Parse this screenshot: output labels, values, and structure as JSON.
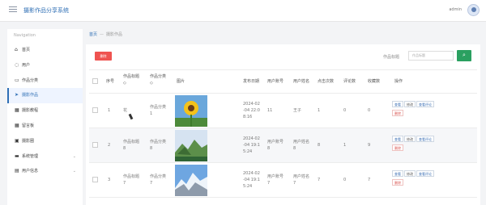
{
  "header": {
    "title": "摄影作品分享系统",
    "user": "admin"
  },
  "sidebar": {
    "title": "Navigation",
    "items": [
      {
        "label": "首页",
        "icon": "home-icon"
      },
      {
        "label": "用户",
        "icon": "user-icon"
      },
      {
        "label": "作品分类",
        "icon": "monitor-icon"
      },
      {
        "label": "摄影作品",
        "icon": "send-icon"
      },
      {
        "label": "摄影教程",
        "icon": "tutorial-icon"
      },
      {
        "label": "留言板",
        "icon": "grid-icon"
      },
      {
        "label": "摄影圈",
        "icon": "circle-icon"
      },
      {
        "label": "系统管理",
        "icon": "settings-icon"
      },
      {
        "label": "用户信息",
        "icon": "user-info-icon"
      }
    ]
  },
  "breadcrumb": {
    "home": "首页",
    "separator": "—",
    "current": "摄影作品"
  },
  "toolbar": {
    "delete_label": "删除",
    "search_label": "作品标题",
    "search_placeholder": "作品标题",
    "search_icon": "search-icon"
  },
  "table": {
    "headers": [
      "序号",
      "作品标题",
      "作品分类",
      "图片",
      "发布日期",
      "用户账号",
      "用户姓名",
      "点击次数",
      "评论数",
      "收藏数",
      "操作"
    ],
    "sort_marks": [
      "◇",
      "◇"
    ],
    "rows": [
      {
        "index": "1",
        "title": "花",
        "category": "作品分类\n1",
        "date": "2024-02\n-04 22:0\n8:16",
        "account": "11",
        "name": "王子",
        "clicks": "1",
        "comments": "0",
        "favorites": "0",
        "image": "sunflower-photo"
      },
      {
        "index": "2",
        "title": "作品标题\n8",
        "category": "作品分类\n8",
        "date": "2024-02\n-04 19:1\n5:24",
        "account": "用户账号\n8",
        "name": "用户姓名\n8",
        "clicks": "8",
        "comments": "1",
        "favorites": "9",
        "image": "mountain-photo"
      },
      {
        "index": "3",
        "title": "作品标题\n7",
        "category": "作品分类\n7",
        "date": "2024-02\n-04 19:1\n5:24",
        "account": "用户账号\n7",
        "name": "用户姓名\n7",
        "clicks": "7",
        "comments": "0",
        "favorites": "7",
        "image": "glacier-photo"
      }
    ],
    "actions": {
      "view": "查看",
      "edit": "修改",
      "view_comments": "查看评论",
      "delete": "删除"
    }
  },
  "colors": {
    "brand": "#2f6fb5",
    "danger": "#ef5350",
    "success": "#2aa060"
  }
}
